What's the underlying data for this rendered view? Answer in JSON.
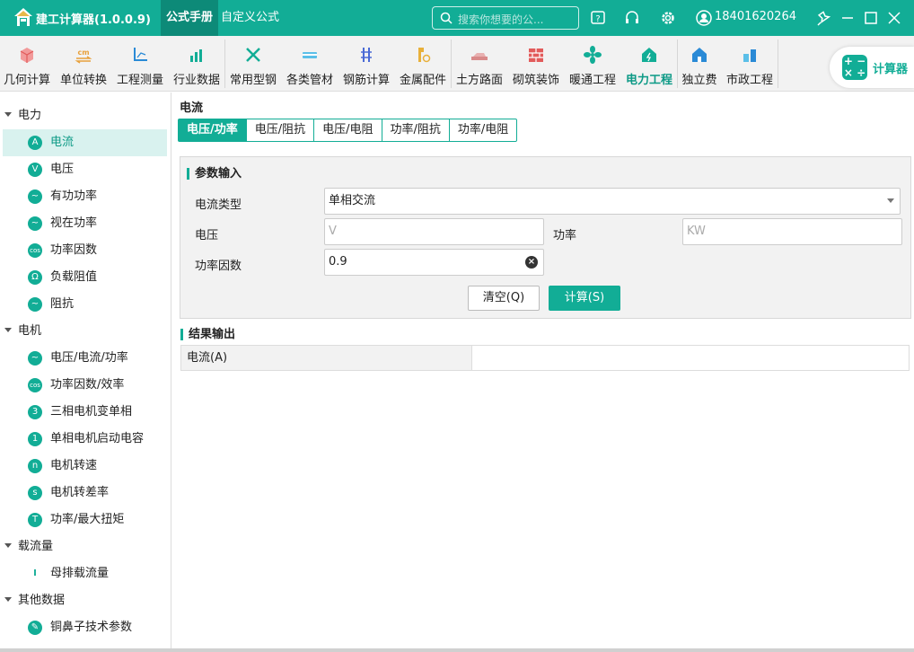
{
  "app": {
    "title": "建工计算器(1.0.0.9)"
  },
  "top_tabs": [
    {
      "label": "公式手册"
    },
    {
      "label": "自定义公式"
    }
  ],
  "search": {
    "placeholder": "搜索你想要的公..."
  },
  "user": {
    "phone": "18401620264"
  },
  "toolbar": {
    "items": [
      {
        "label": "几何计算"
      },
      {
        "label": "单位转换"
      },
      {
        "label": "工程测量"
      },
      {
        "label": "行业数据"
      },
      {
        "label": "常用型钢"
      },
      {
        "label": "各类管材"
      },
      {
        "label": "钢筋计算"
      },
      {
        "label": "金属配件"
      },
      {
        "label": "土方路面"
      },
      {
        "label": "砌筑装饰"
      },
      {
        "label": "暖通工程"
      },
      {
        "label": "电力工程"
      },
      {
        "label": "独立费"
      },
      {
        "label": "市政工程"
      }
    ],
    "calculator_label": "计算器"
  },
  "sidebar": {
    "groups": [
      {
        "label": "电力",
        "items": [
          {
            "label": "电流",
            "icon": "A"
          },
          {
            "label": "电压",
            "icon": "V"
          },
          {
            "label": "有功功率",
            "icon": "~"
          },
          {
            "label": "视在功率",
            "icon": "~"
          },
          {
            "label": "功率因数",
            "icon": "cos"
          },
          {
            "label": "负载阻值",
            "icon": "Ω"
          },
          {
            "label": "阻抗",
            "icon": "~"
          }
        ]
      },
      {
        "label": "电机",
        "items": [
          {
            "label": "电压/电流/功率",
            "icon": "~"
          },
          {
            "label": "功率因数/效率",
            "icon": "cos"
          },
          {
            "label": "三相电机变单相",
            "icon": "3"
          },
          {
            "label": "单相电机启动电容",
            "icon": "1"
          },
          {
            "label": "电机转速",
            "icon": "n"
          },
          {
            "label": "电机转差率",
            "icon": "s"
          },
          {
            "label": "功率/最大扭矩",
            "icon": "T"
          }
        ]
      },
      {
        "label": "载流量",
        "items": [
          {
            "label": "母排载流量",
            "icon": "I"
          }
        ]
      },
      {
        "label": "其他数据",
        "items": [
          {
            "label": "铜鼻子技术参数",
            "icon": "✎"
          }
        ]
      }
    ]
  },
  "main": {
    "title": "电流",
    "tabs": [
      {
        "label": "电压/功率"
      },
      {
        "label": "电压/阻抗"
      },
      {
        "label": "电压/电阻"
      },
      {
        "label": "功率/阻抗"
      },
      {
        "label": "功率/电阻"
      }
    ],
    "input_section": "参数输入",
    "current_type_label": "电流类型",
    "current_type_value": "单相交流",
    "voltage_label": "电压",
    "voltage_placeholder": "V",
    "power_label": "功率",
    "power_placeholder": "KW",
    "pf_label": "功率因数",
    "pf_value": "0.9",
    "clear_button": "清空(Q)",
    "calc_button": "计算(S)",
    "output_section": "结果输出",
    "result_label": "电流(A)",
    "result_value": ""
  },
  "colors": {
    "accent": "#12ad96",
    "accent_dark": "#0d8a78"
  }
}
